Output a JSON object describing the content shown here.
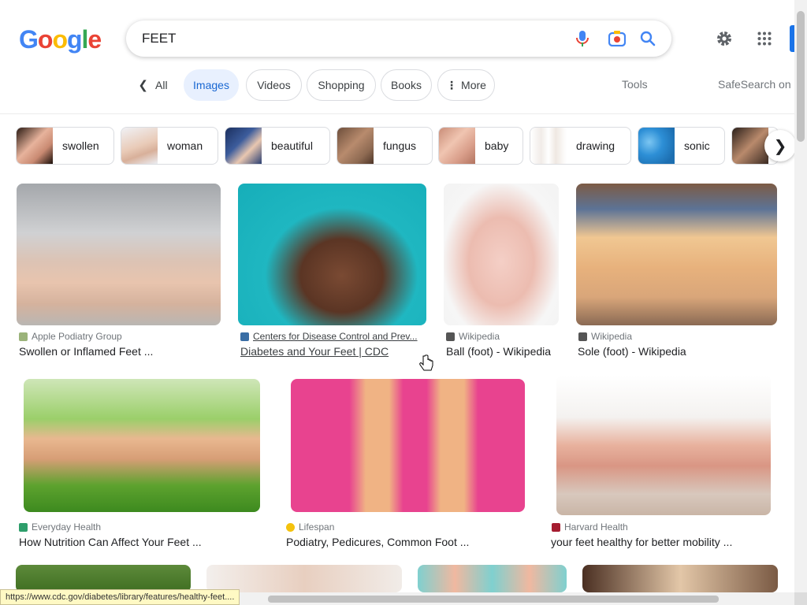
{
  "logo": {
    "text": "Google",
    "letters": [
      {
        "ch": "G",
        "color": "#4285F4"
      },
      {
        "ch": "o",
        "color": "#EA4335"
      },
      {
        "ch": "o",
        "color": "#FBBC05"
      },
      {
        "ch": "g",
        "color": "#4285F4"
      },
      {
        "ch": "l",
        "color": "#34A853"
      },
      {
        "ch": "e",
        "color": "#EA4335"
      }
    ]
  },
  "search": {
    "query": "FEET"
  },
  "icons": {
    "mic": "microphone-icon",
    "lens": "camera-lens-icon",
    "search": "search-icon",
    "settings": "gear-icon",
    "apps": "apps-grid-icon"
  },
  "tabs": {
    "all": "All",
    "images": "Images",
    "videos": "Videos",
    "shopping": "Shopping",
    "books": "Books",
    "more": "More",
    "tools": "Tools",
    "safesearch": "SafeSearch on"
  },
  "chips": [
    {
      "label": "swollen"
    },
    {
      "label": "woman"
    },
    {
      "label": "beautiful"
    },
    {
      "label": "fungus"
    },
    {
      "label": "baby"
    },
    {
      "label": "drawing"
    },
    {
      "label": "sonic"
    }
  ],
  "results": [
    {
      "source": "Apple Podiatry Group",
      "title": "Swollen or Inflamed Feet ...",
      "fav_color": "#9bb37a"
    },
    {
      "source": "Centers for Disease Control and Prev...",
      "title": "Diabetes and Your Feet | CDC",
      "fav_color": "#3a6ea5"
    },
    {
      "source": "Wikipedia",
      "title": "Ball (foot) - Wikipedia",
      "fav_color": "#555555"
    },
    {
      "source": "Wikipedia",
      "title": "Sole (foot) - Wikipedia",
      "fav_color": "#555555"
    },
    {
      "source": "Everyday Health",
      "title": "How Nutrition Can Affect Your Feet ...",
      "fav_color": "#2e9e6b"
    },
    {
      "source": "Lifespan",
      "title": "Podiatry, Pedicures, Common Foot ...",
      "fav_color": "#f4c20d"
    },
    {
      "source": "Harvard Health",
      "title": "your feet healthy for better mobility ...",
      "fav_color": "#a51c30"
    }
  ],
  "status_url": "https://www.cdc.gov/diabetes/library/features/healthy-feet...."
}
